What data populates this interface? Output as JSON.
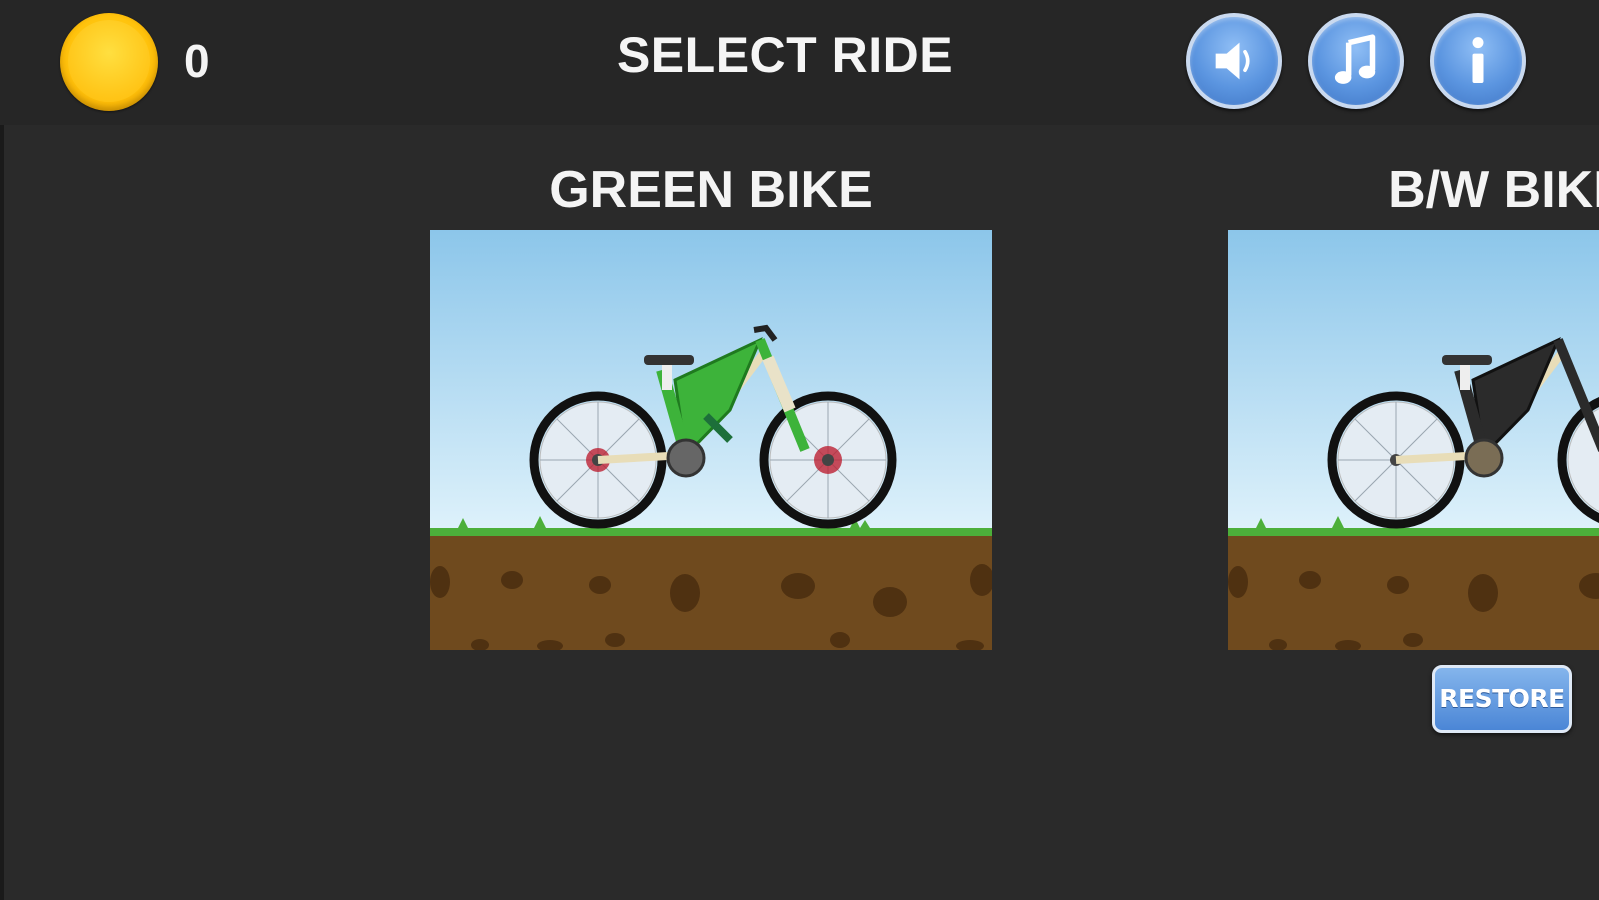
{
  "topbar": {
    "coin_icon": "gold-coin-icon",
    "coin_count": "0",
    "title": "SELECT RIDE",
    "buttons": [
      {
        "name": "sound",
        "icon": "speaker-icon"
      },
      {
        "name": "music",
        "icon": "music-note-icon"
      },
      {
        "name": "info",
        "icon": "info-icon"
      }
    ]
  },
  "bikes": [
    {
      "title": "GREEN BIKE",
      "frame_color": "#3db33a"
    },
    {
      "title": "B/W BIKE",
      "frame_color": "#2b2b2b"
    }
  ],
  "restore_label": "RESTORE",
  "colors": {
    "background": "#2a2a2a",
    "accent_blue": "#5b95e0",
    "coin": "#ffc30d",
    "sky": "#bfe1f5",
    "ground": "#6f4a1e",
    "grass": "#4caf3a"
  }
}
